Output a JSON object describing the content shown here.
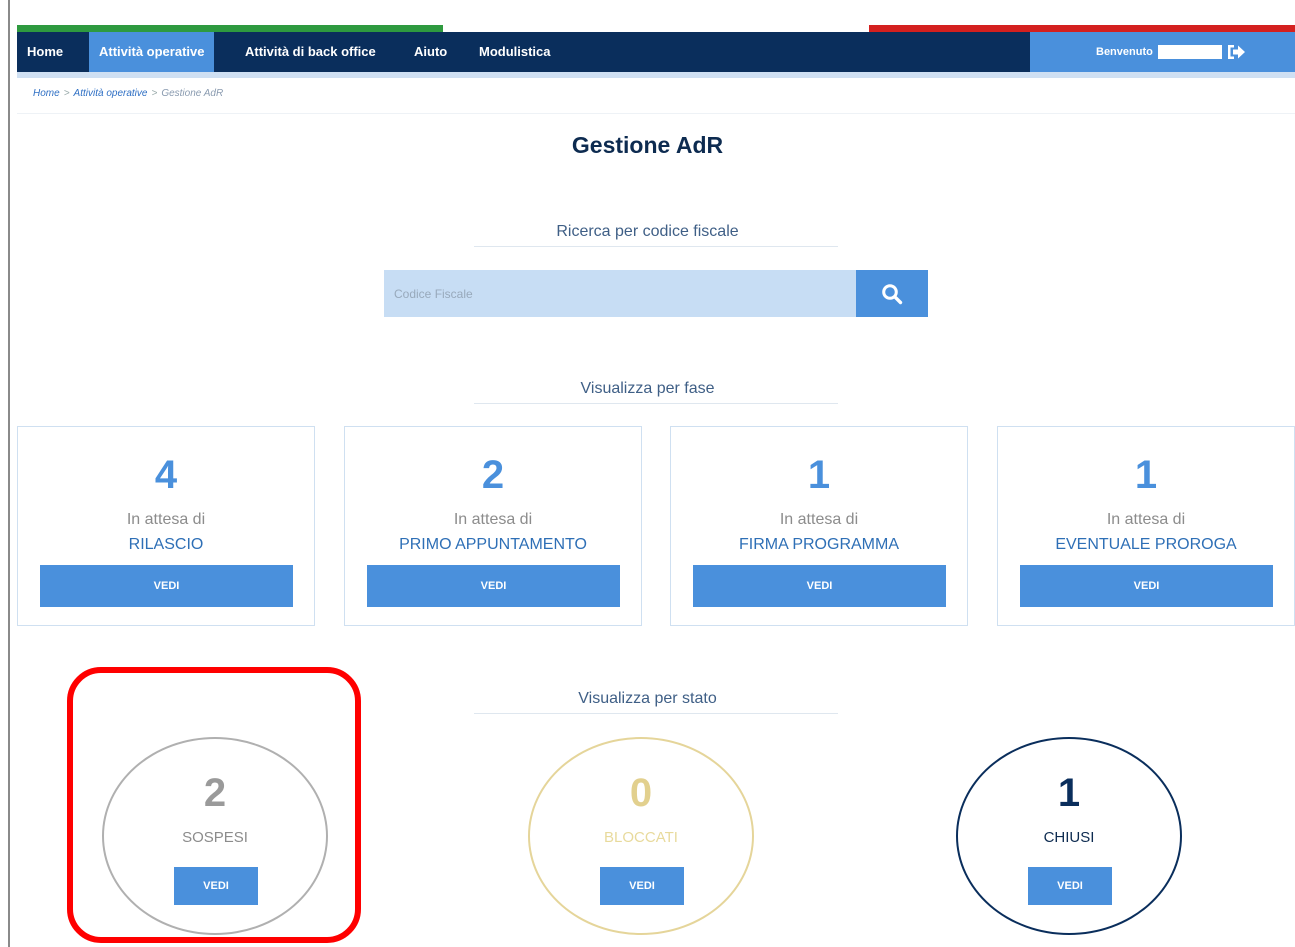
{
  "colors": {
    "flag": [
      "#2e9a3f",
      "#ffffff",
      "#d4201f"
    ],
    "nav_bg": "#0a2e5c",
    "accent": "#4a90dc",
    "highlight": "#ff0000"
  },
  "nav": {
    "items": [
      {
        "label": "Home",
        "active": false
      },
      {
        "label": "Attività operative",
        "active": true
      },
      {
        "label": "Attività di back office",
        "active": false
      },
      {
        "label": "Aiuto",
        "active": false
      },
      {
        "label": "Modulistica",
        "active": false
      }
    ],
    "welcome_label": "Benvenuto"
  },
  "breadcrumb": {
    "home": "Home",
    "section": "Attività operative",
    "current": "Gestione AdR",
    "separator": ">"
  },
  "page_title": "Gestione AdR",
  "search": {
    "title": "Ricerca per codice fiscale",
    "placeholder": "Codice Fiscale",
    "value": "",
    "icon": "search-icon"
  },
  "phases": {
    "title": "Visualizza per fase",
    "cards": [
      {
        "count": "4",
        "label": "In attesa di",
        "name": "RILASCIO",
        "button": "VEDI"
      },
      {
        "count": "2",
        "label": "In attesa di",
        "name": "PRIMO APPUNTAMENTO",
        "button": "VEDI"
      },
      {
        "count": "1",
        "label": "In attesa di",
        "name": "FIRMA PROGRAMMA",
        "button": "VEDI"
      },
      {
        "count": "1",
        "label": "In attesa di",
        "name": "EVENTUALE PROROGA",
        "button": "VEDI"
      }
    ]
  },
  "states": {
    "title": "Visualizza per stato",
    "items": [
      {
        "count": "2",
        "name": "SOSPESI",
        "button": "VEDI",
        "color": "#b0b0b0",
        "count_color": "#9a9a9a",
        "name_color": "#8c8c8c"
      },
      {
        "count": "0",
        "name": "BLOCCATI",
        "button": "VEDI",
        "color": "#e5d59a",
        "count_color": "#e2d08e",
        "name_color": "#e8da9c"
      },
      {
        "count": "1",
        "name": "CHIUSI",
        "button": "VEDI",
        "color": "#0a2e5c",
        "count_color": "#0a2e5c",
        "name_color": "#0d2b50"
      }
    ]
  }
}
